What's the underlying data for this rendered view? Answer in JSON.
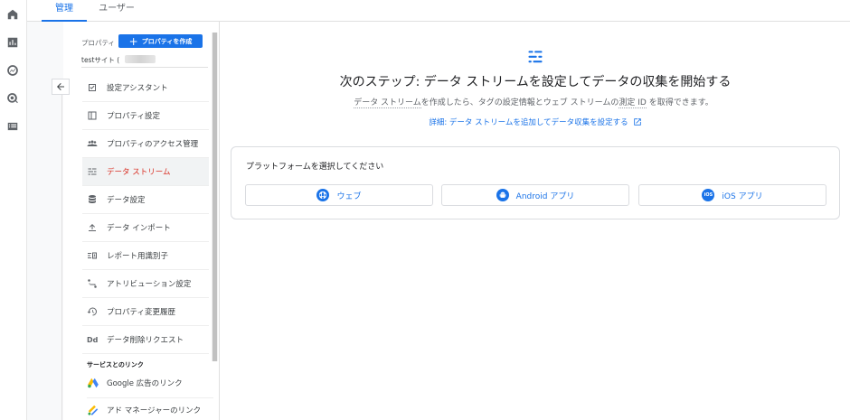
{
  "tabs": [
    {
      "label": "管理",
      "active": true
    },
    {
      "label": "ユーザー",
      "active": false
    }
  ],
  "rail": {
    "icons": [
      "home-icon",
      "reports-icon",
      "explore-icon",
      "advertising-icon",
      "list-icon"
    ]
  },
  "property": {
    "label": "プロパティ",
    "create_button": "プロパティを作成",
    "site_name": "testサイト ("
  },
  "menu": {
    "items": [
      {
        "label": "設定アシスタント",
        "icon": "checklist-icon",
        "active": false
      },
      {
        "label": "プロパティ設定",
        "icon": "property-settings-icon",
        "active": false
      },
      {
        "label": "プロパティのアクセス管理",
        "icon": "people-icon",
        "active": false
      },
      {
        "label": "データ ストリーム",
        "icon": "data-stream-icon",
        "active": true
      },
      {
        "label": "データ設定",
        "icon": "database-icon",
        "active": false
      },
      {
        "label": "データ インポート",
        "icon": "upload-icon",
        "active": false
      },
      {
        "label": "レポート用識別子",
        "icon": "identifier-icon",
        "active": false
      },
      {
        "label": "アトリビューション設定",
        "icon": "attribution-icon",
        "active": false
      },
      {
        "label": "プロパティ変更履歴",
        "icon": "history-icon",
        "active": false
      },
      {
        "label": "データ削除リクエスト",
        "icon": "dd-icon",
        "active": false
      }
    ]
  },
  "links": {
    "heading": "サービスとのリンク",
    "items": [
      {
        "label": "Google 広告のリンク",
        "icon": "google-ads-icon"
      },
      {
        "label": "アド マネージャーのリンク",
        "icon": "ad-manager-icon"
      }
    ]
  },
  "main": {
    "title": "次のステップ: データ ストリームを設定してデータの収集を開始する",
    "subtitle_part1": "データ ストリーム",
    "subtitle_part2": "を作成したら、タグの設定情報とウェブ ストリームの",
    "subtitle_part3": "測定 ID",
    "subtitle_part4": " を取得できます。",
    "help_link": "詳細: データ ストリームを追加してデータ収集を設定する",
    "platform_title": "プラットフォームを選択してください",
    "platforms": [
      {
        "label": "ウェブ",
        "icon": "globe-icon"
      },
      {
        "label": "Android アプリ",
        "icon": "android-icon"
      },
      {
        "label": "iOS アプリ",
        "icon": "ios-icon",
        "badge": "iOS"
      }
    ]
  },
  "colors": {
    "accent": "#1a73e8",
    "active_text": "#d93025"
  }
}
